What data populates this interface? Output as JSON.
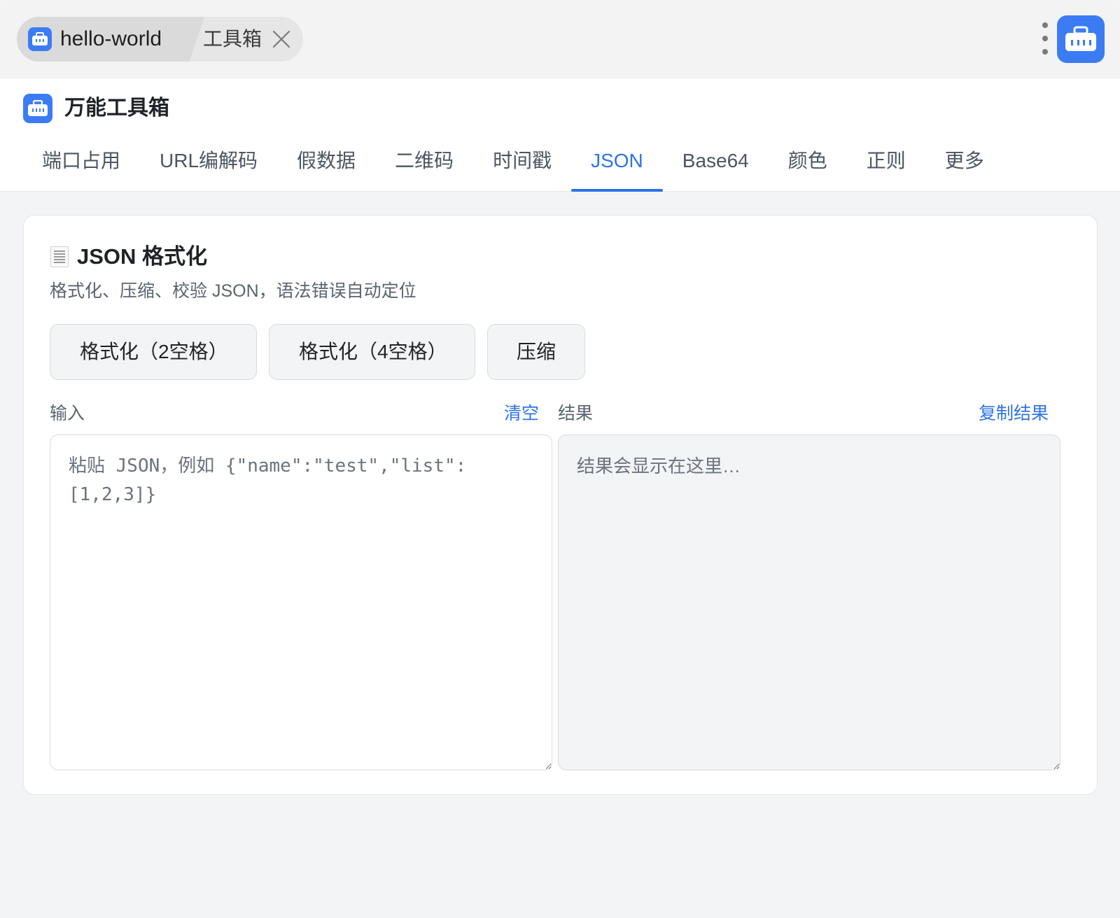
{
  "topbar": {
    "app_label": "hello-world",
    "tool_label": "工具箱",
    "icons": {
      "app": "toolbox-icon",
      "close": "close-icon",
      "more": "more-vertical-icon"
    }
  },
  "header": {
    "brand_title": "万能工具箱",
    "tabs": [
      {
        "label": "端口占用"
      },
      {
        "label": "URL编解码"
      },
      {
        "label": "假数据"
      },
      {
        "label": "二维码"
      },
      {
        "label": "时间戳"
      },
      {
        "label": "JSON",
        "active": true
      },
      {
        "label": "Base64"
      },
      {
        "label": "颜色"
      },
      {
        "label": "正则"
      },
      {
        "label": "更多"
      }
    ]
  },
  "card": {
    "title": "JSON 格式化",
    "title_icon": "receipt-icon",
    "subtitle": "格式化、压缩、校验 JSON，语法错误自动定位",
    "buttons": {
      "format2": "格式化（2空格）",
      "format4": "格式化（4空格）",
      "minify": "压缩"
    },
    "input": {
      "label": "输入",
      "clear": "清空",
      "value": "",
      "placeholder": "粘贴 JSON，例如 {\"name\":\"test\",\"list\":[1,2,3]}"
    },
    "output": {
      "label": "结果",
      "copy": "复制结果",
      "value": "",
      "placeholder": "结果会显示在这里…"
    }
  },
  "colors": {
    "accent": "#2f74e6",
    "icon_bg": "#3b7cf5",
    "page_bg": "#f3f4f6"
  }
}
